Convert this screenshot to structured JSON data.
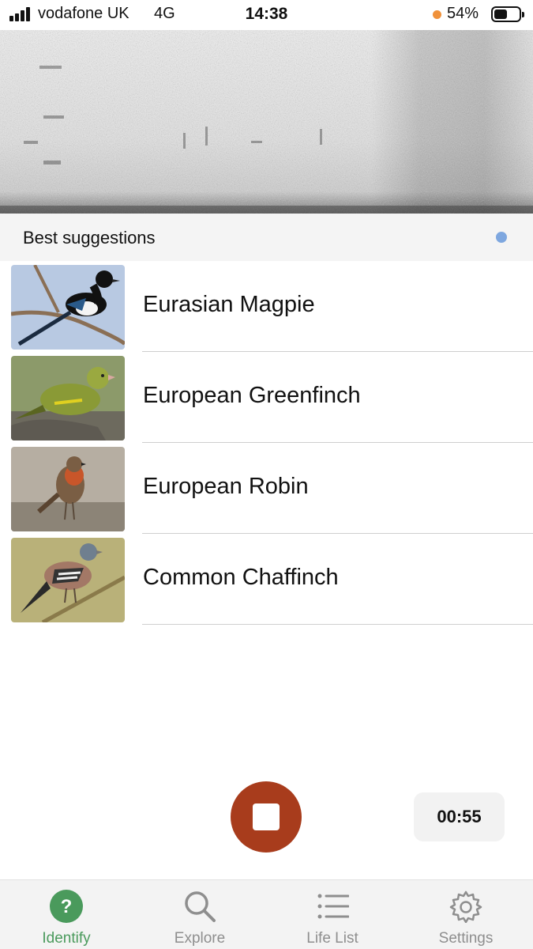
{
  "status_bar": {
    "carrier": "vodafone UK",
    "network": "4G",
    "time": "14:38",
    "battery": "54%",
    "battery_level": 0.54,
    "mic_indicator_color": "#f0913a"
  },
  "header": {
    "title": "Best suggestions",
    "indicator_color": "#7ea7df"
  },
  "suggestions": [
    {
      "name": "Eurasian Magpie",
      "image": "magpie-photo"
    },
    {
      "name": "European Greenfinch",
      "image": "greenfinch-photo"
    },
    {
      "name": "European Robin",
      "image": "robin-photo"
    },
    {
      "name": "Common Chaffinch",
      "image": "chaffinch-photo"
    }
  ],
  "recorder": {
    "stop_button_color": "#a83c1c",
    "elapsed": "00:55"
  },
  "tabs": [
    {
      "label": "Identify",
      "icon": "question-circle-icon",
      "active": true
    },
    {
      "label": "Explore",
      "icon": "search-icon",
      "active": false
    },
    {
      "label": "Life List",
      "icon": "list-icon",
      "active": false
    },
    {
      "label": "Settings",
      "icon": "gear-icon",
      "active": false
    }
  ],
  "colors": {
    "active_tab": "#4a9a5c",
    "inactive_tab": "#8e8e8e"
  }
}
